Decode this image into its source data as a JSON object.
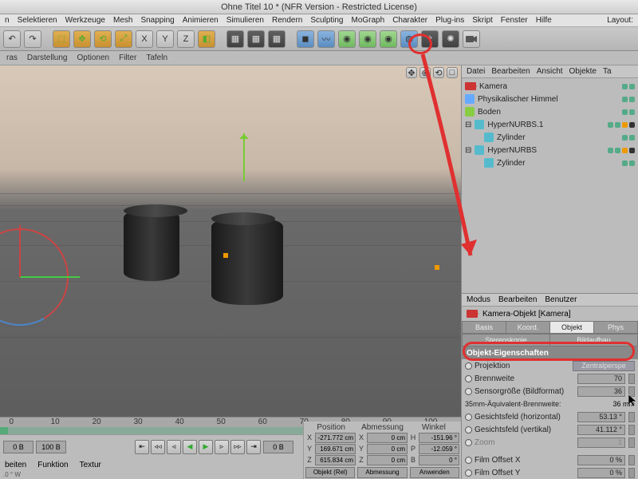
{
  "title": "Ohne Titel 10 * (NFR Version - Restricted License)",
  "menus": [
    "n",
    "Selektieren",
    "Werkzeuge",
    "Mesh",
    "Snapping",
    "Animieren",
    "Simulieren",
    "Rendern",
    "Sculpting",
    "MoGraph",
    "Charakter",
    "Plug-ins",
    "Skript",
    "Fenster",
    "Hilfe"
  ],
  "layout_label": "Layout:",
  "subbar": [
    "ras",
    "Darstellung",
    "Optionen",
    "Filter",
    "Tafeln"
  ],
  "right_tabs": [
    "Datei",
    "Bearbeiten",
    "Ansicht",
    "Objekte",
    "Ta"
  ],
  "tree": [
    {
      "name": "Kamera",
      "icon": "#c33",
      "dots": [
        "g",
        "g"
      ]
    },
    {
      "name": "Physikalischer Himmel",
      "icon": "#6af",
      "dots": [
        "g",
        "g"
      ]
    },
    {
      "name": "Boden",
      "icon": "#8c4",
      "dots": [
        "g",
        "g"
      ]
    },
    {
      "name": "HyperNURBS.1",
      "icon": "#5bc",
      "dots": [
        "g",
        "g"
      ],
      "expand": true,
      "extra": true
    },
    {
      "name": "Zylinder",
      "icon": "#5bc",
      "indent": 2,
      "dots": [
        "g",
        "g"
      ]
    },
    {
      "name": "HyperNURBS",
      "icon": "#5bc",
      "dots": [
        "g",
        "g"
      ],
      "expand": true,
      "extra": true
    },
    {
      "name": "Zylinder",
      "icon": "#5bc",
      "indent": 2,
      "dots": [
        "g",
        "g"
      ]
    }
  ],
  "attr_tabs": [
    "Modus",
    "Bearbeiten",
    "Benutzer"
  ],
  "attr_title": "Kamera-Objekt [Kamera]",
  "obj_tabs1": {
    "basis": "Basis",
    "koord": "Koord.",
    "objekt": "Objekt",
    "phys": "Phys"
  },
  "obj_tabs2": {
    "stereo": "Stereoskopie",
    "bild": "Bildaufbau"
  },
  "section": "Objekt-Eigenschaften",
  "props": {
    "projektion": {
      "label": "Projektion",
      "value": "Zentralperspe"
    },
    "brennweite": {
      "label": "Brennweite",
      "value": "70"
    },
    "sensor": {
      "label": "Sensorgröße (Bildformat)",
      "value": "36"
    },
    "equiv": {
      "label": "35mm-Äquivalent-Brennweite:",
      "value": "36 mm"
    },
    "fovh": {
      "label": "Gesichtsfeld (horizontal)",
      "value": "53.13 °"
    },
    "fovv": {
      "label": "Gesichtsfeld (vertikal)",
      "value": "41.112 °"
    },
    "zoom": {
      "label": "Zoom",
      "value": "1"
    },
    "offx": {
      "label": "Film Offset X",
      "value": "0 %"
    },
    "offy": {
      "label": "Film Offset Y",
      "value": "0 %"
    }
  },
  "timeline": {
    "ticks": [
      "0",
      "10",
      "20",
      "30",
      "40",
      "50",
      "60",
      "70",
      "80",
      "90",
      "100"
    ],
    "start": "0 B",
    "end": "100 B",
    "cur": "0 B",
    "cur2": "0"
  },
  "bottom_tabs": [
    "beiten",
    "Funktion",
    "Textur"
  ],
  "coords": {
    "hdrs": [
      "Position",
      "Abmessung",
      "Winkel"
    ],
    "rows": [
      {
        "l": "X",
        "p": "-271.772 cm",
        "a": "0 cm",
        "w": "-151.96 °"
      },
      {
        "l": "Y",
        "p": "169.671 cm",
        "a": "0 cm",
        "w": "-12.059 °"
      },
      {
        "l": "Z",
        "p": "615.834 cm",
        "a": "0 cm",
        "w": "0 °"
      }
    ],
    "mode1": "Objekt (Rel)",
    "mode2": "Abmessung",
    "apply": "Anwenden"
  },
  "status": ".0 °   W"
}
